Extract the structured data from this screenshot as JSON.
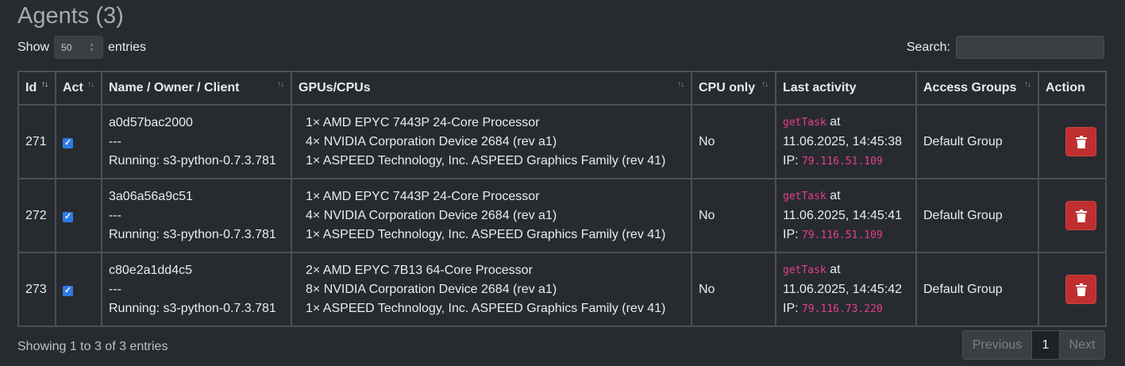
{
  "title": "Agents (3)",
  "length": {
    "show_label": "Show",
    "value": "50",
    "entries_label": "entries"
  },
  "search": {
    "label": "Search:",
    "value": ""
  },
  "columns": [
    "Id",
    "Act",
    "Name / Owner / Client",
    "GPUs/CPUs",
    "CPU only",
    "Last activity",
    "Access Groups",
    "Action"
  ],
  "rows": [
    {
      "id": "271",
      "active": true,
      "name": "a0d57bac2000",
      "owner": "---",
      "client": "Running: s3-python-0.7.3.781",
      "hw": [
        "1× AMD EPYC 7443P 24-Core Processor",
        "4× NVIDIA Corporation Device 2684 (rev a1)",
        "1× ASPEED Technology, Inc. ASPEED Graphics Family (rev 41)"
      ],
      "cpu_only": "No",
      "activity_action": "getTask",
      "activity_at": "at",
      "activity_time": "11.06.2025, 14:45:38",
      "ip_label": "IP:",
      "ip": "79.116.51.109",
      "group": "Default Group"
    },
    {
      "id": "272",
      "active": true,
      "name": "3a06a56a9c51",
      "owner": "---",
      "client": "Running: s3-python-0.7.3.781",
      "hw": [
        "1× AMD EPYC 7443P 24-Core Processor",
        "4× NVIDIA Corporation Device 2684 (rev a1)",
        "1× ASPEED Technology, Inc. ASPEED Graphics Family (rev 41)"
      ],
      "cpu_only": "No",
      "activity_action": "getTask",
      "activity_at": "at",
      "activity_time": "11.06.2025, 14:45:41",
      "ip_label": "IP:",
      "ip": "79.116.51.109",
      "group": "Default Group"
    },
    {
      "id": "273",
      "active": true,
      "name": "c80e2a1dd4c5",
      "owner": "---",
      "client": "Running: s3-python-0.7.3.781",
      "hw": [
        "2× AMD EPYC 7B13 64-Core Processor",
        "8× NVIDIA Corporation Device 2684 (rev a1)",
        "1× ASPEED Technology, Inc. ASPEED Graphics Family (rev 41)"
      ],
      "cpu_only": "No",
      "activity_action": "getTask",
      "activity_at": "at",
      "activity_time": "11.06.2025, 14:45:42",
      "ip_label": "IP:",
      "ip": "79.116.73.220",
      "group": "Default Group"
    }
  ],
  "info": "Showing 1 to 3 of 3 entries",
  "pagination": {
    "previous": "Previous",
    "current": "1",
    "next": "Next"
  },
  "colors": {
    "background": "#272b30",
    "accent_code": "#e83e8c",
    "delete_button": "#bf2f2f",
    "checkbox": "#2f7ae5"
  },
  "icons": {
    "delete": "trash-icon",
    "active": "checkbox-checked-icon"
  }
}
